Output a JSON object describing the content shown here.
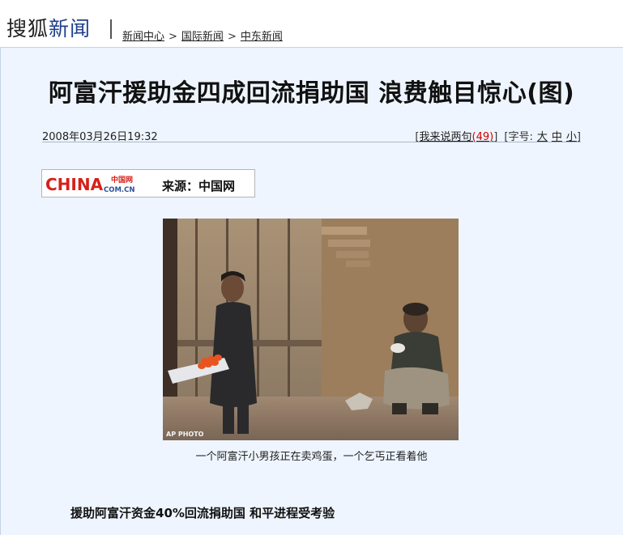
{
  "header": {
    "logo_part1": "搜狐",
    "logo_part2": "新闻",
    "breadcrumb": [
      "新闻中心",
      "国际新闻",
      "中东新闻"
    ],
    "breadcrumb_sep": ">"
  },
  "article": {
    "title": "阿富汗援助金四成回流捐助国 浪费触目惊心(图)",
    "datetime": "2008年03月26日19:32",
    "comment_open": "[",
    "comment_link": "我来说两句",
    "comment_count": "(49)",
    "comment_close": "]",
    "font_size_label": "[字号:",
    "font_sizes": [
      "大",
      "中",
      "小"
    ],
    "font_size_close": "]",
    "source_label": "来源：中国网",
    "source_logo_text": "CHINA",
    "source_logo_cn": "中国网",
    "source_logo_dom": "COM.CN",
    "photo_credit": "AP PHOTO",
    "photo_caption": "一个阿富汗小男孩正在卖鸡蛋，一个乞丐正看着他",
    "subheading": "援助阿富汗资金40%回流捐助国 和平进程受考验"
  }
}
